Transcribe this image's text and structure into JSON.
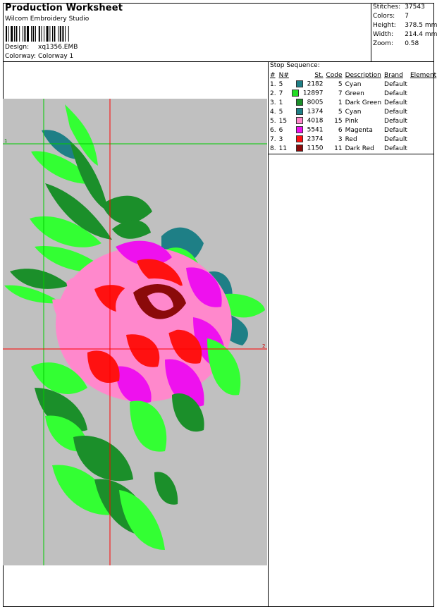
{
  "header": {
    "title": "Production Worksheet",
    "company": "Wilcom Embroidery Studio",
    "design_label": "Design:",
    "design_value": "xq1356.EMB",
    "colorway_label": "Colorway:",
    "colorway_value": "Colorway 1"
  },
  "stats": [
    {
      "label": "Stitches:",
      "value": "37543"
    },
    {
      "label": "Colors:",
      "value": "7"
    },
    {
      "label": "Height:",
      "value": "378.5 mm"
    },
    {
      "label": "Width:",
      "value": "214.4 mm"
    },
    {
      "label": "Zoom:",
      "value": "0.58"
    }
  ],
  "stop_sequence": {
    "title": "Stop Sequence:",
    "headers": [
      "#",
      "N#",
      "St.",
      "Code",
      "Description",
      "Brand",
      "Element"
    ],
    "rows": [
      {
        "idx": "1.",
        "n": "5",
        "color": "#1e7f86",
        "st": "2182",
        "code": "5",
        "desc": "Cyan",
        "brand": "Default",
        "element": ""
      },
      {
        "idx": "2.",
        "n": "7",
        "color": "#22dd22",
        "st": "12897",
        "code": "7",
        "desc": "Green",
        "brand": "Default",
        "element": ""
      },
      {
        "idx": "3.",
        "n": "1",
        "color": "#1b8f2a",
        "st": "8005",
        "code": "1",
        "desc": "Dark Green",
        "brand": "Default",
        "element": ""
      },
      {
        "idx": "4.",
        "n": "5",
        "color": "#1e7f86",
        "st": "1374",
        "code": "5",
        "desc": "Cyan",
        "brand": "Default",
        "element": ""
      },
      {
        "idx": "5.",
        "n": "15",
        "color": "#ff88cc",
        "st": "4018",
        "code": "15",
        "desc": "Pink",
        "brand": "Default",
        "element": ""
      },
      {
        "idx": "6.",
        "n": "6",
        "color": "#ee11ee",
        "st": "5541",
        "code": "6",
        "desc": "Magenta",
        "brand": "Default",
        "element": ""
      },
      {
        "idx": "7.",
        "n": "3",
        "color": "#ff1111",
        "st": "2374",
        "code": "3",
        "desc": "Red",
        "brand": "Default",
        "element": ""
      },
      {
        "idx": "8.",
        "n": "11",
        "color": "#8b0a0a",
        "st": "1150",
        "code": "11",
        "desc": "Dark Red",
        "brand": "Default",
        "element": ""
      }
    ]
  },
  "preview": {
    "background": "#c0c0c0",
    "marker_h": "1",
    "marker_v": "2"
  }
}
